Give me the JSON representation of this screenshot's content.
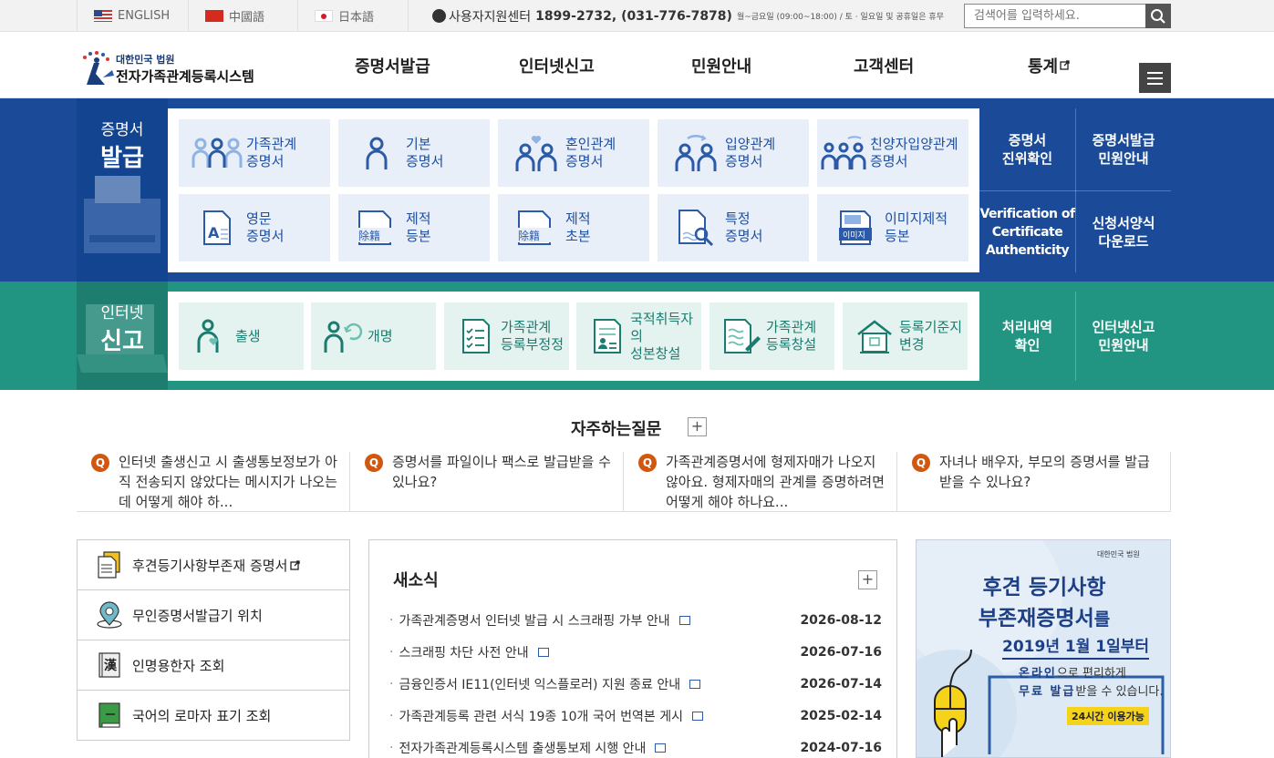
{
  "topbar": {
    "languages": [
      {
        "label": "ENGLISH",
        "flag": "us-flag"
      },
      {
        "label": "中國語",
        "flag": "cn-flag"
      },
      {
        "label": "日本語",
        "flag": "jp-flag"
      }
    ],
    "support_label": "사용자지원센터",
    "support_phone": "1899-2732, (031-776-7878)",
    "support_hours": "월~금요일 (09:00~18:00) / 토 · 일요일 및 공휴일은 휴무",
    "search_placeholder": "검색어를 입력하세요."
  },
  "logo": {
    "small": "대한민국 법원",
    "title": "전자가족관계등록시스템"
  },
  "nav": [
    "증명서발급",
    "인터넷신고",
    "민원안내",
    "고객센터",
    "통계"
  ],
  "issue": {
    "title_small": "증명서",
    "title_big": "발급",
    "tiles": [
      {
        "label": "가족관계\n증명서",
        "icon": "family-icon"
      },
      {
        "label": "기본\n증명서",
        "icon": "person-icon"
      },
      {
        "label": "혼인관계\n증명서",
        "icon": "couple-heart-icon"
      },
      {
        "label": "입양관계\n증명서",
        "icon": "adoption-icon"
      },
      {
        "label": "친양자입양관계\n증명서",
        "icon": "family-adoption-icon"
      },
      {
        "label": "영문\n증명서",
        "icon": "english-doc-icon"
      },
      {
        "label": "제적\n등본",
        "icon": "removed-register-icon"
      },
      {
        "label": "제적\n초본",
        "icon": "removed-abstract-icon"
      },
      {
        "label": "특정\n증명서",
        "icon": "search-doc-icon"
      },
      {
        "label": "이미지제적\n등본",
        "icon": "image-register-icon"
      }
    ],
    "side_links": [
      "증명서\n진위확인",
      "증명서발급\n민원안내",
      "Verification of\nCertificate\nAuthenticity",
      "신청서양식\n다운로드"
    ]
  },
  "report": {
    "title_small": "인터넷",
    "title_big": "신고",
    "tiles": [
      {
        "label": "출생",
        "icon": "birth-icon"
      },
      {
        "label": "개명",
        "icon": "rename-icon"
      },
      {
        "label": "가족관계\n등록부정정",
        "icon": "correction-doc-icon"
      },
      {
        "label": "국적취득자의\n성본창설",
        "icon": "nationality-doc-icon"
      },
      {
        "label": "가족관계\n등록창설",
        "icon": "register-create-icon"
      },
      {
        "label": "등록기준지\n변경",
        "icon": "house-icon"
      }
    ],
    "side_links": [
      "처리내역\n확인",
      "인터넷신고\n민원안내"
    ]
  },
  "faq": {
    "title": "자주하는질문",
    "items": [
      "인터넷 출생신고 시 출생통보정보가 아직 전송되지 않았다는 메시지가 나오는데 어떻게 해야 하...",
      "증명서를 파일이나 팩스로 발급받을 수 있나요?",
      "가족관계증명서에 형제자매가 나오지 않아요. 형제자매의 관계를 증명하려면 어떻게 해야 하나요...",
      "자녀나 배우자, 부모의 증명서를 발급받을 수 있나요?"
    ]
  },
  "quick_links": [
    {
      "label": "후견등기사항부존재 증명서",
      "icon": "document-icon"
    },
    {
      "label": "무인증명서발급기 위치",
      "icon": "location-pin-icon"
    },
    {
      "label": "인명용한자 조회",
      "icon": "hanja-book-icon"
    },
    {
      "label": "국어의 로마자 표기 조회",
      "icon": "green-book-icon"
    }
  ],
  "news": {
    "title": "새소식",
    "items": [
      {
        "title": "가족관계증명서 인터넷 발급 시 스크래핑 가부 안내",
        "date": "2026-08-12"
      },
      {
        "title": "스크래핑 차단 사전 안내",
        "date": "2026-07-16"
      },
      {
        "title": "금융인증서 IE11(인터넷 익스플로러) 지원 종료 안내",
        "date": "2026-07-14"
      },
      {
        "title": "가족관계등록 관련 서식 19종 10개 국어 번역본 게시",
        "date": "2025-02-14"
      },
      {
        "title": "전자가족관계등록시스템 출생통보제 시행 안내",
        "date": "2024-07-16"
      }
    ]
  },
  "banner": {
    "org": "대한민국 법원",
    "line1": "후견 등기사항",
    "line2a": "부존재증명서",
    "line2b": "를",
    "line3": "2019년 1월 1일부터",
    "line4a": "온라인",
    "line4b": "으로 편리하게",
    "line5a": "무료 발급",
    "line5b": "받을 수 있습니다.",
    "badge": "24시간 이용가능"
  },
  "colors": {
    "issue_band": "#1b4b98",
    "report_band": "#219482",
    "faq_q": "#d0570f"
  }
}
